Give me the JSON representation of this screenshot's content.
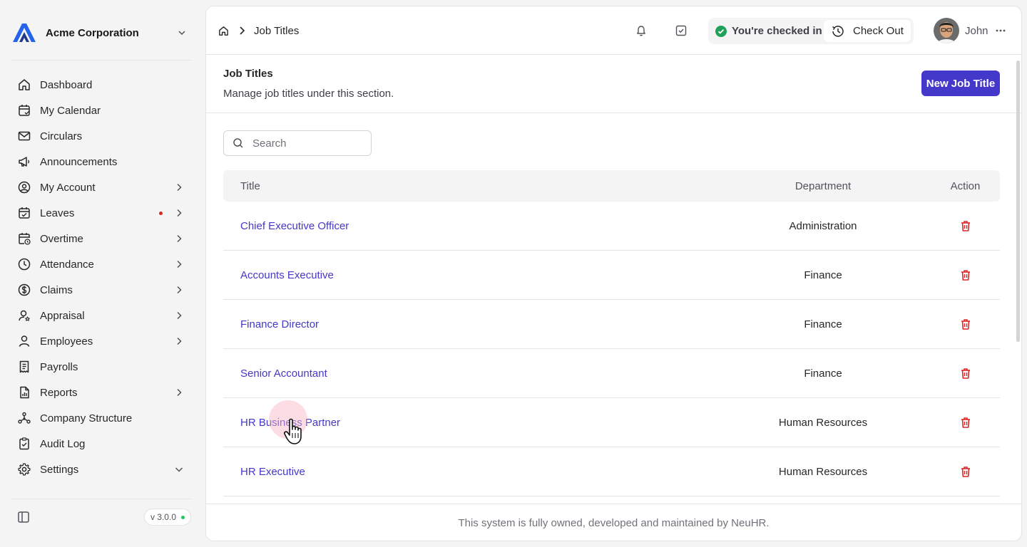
{
  "company": {
    "name": "Acme Corporation"
  },
  "sidebar": {
    "items": [
      {
        "label": "Dashboard",
        "icon": "home-icon",
        "has_arrow": false
      },
      {
        "label": "My Calendar",
        "icon": "calendar-icon",
        "has_arrow": false
      },
      {
        "label": "Circulars",
        "icon": "mail-icon",
        "has_arrow": false
      },
      {
        "label": "Announcements",
        "icon": "megaphone-icon",
        "has_arrow": false
      },
      {
        "label": "My Account",
        "icon": "user-circle-icon",
        "has_arrow": true
      },
      {
        "label": "Leaves",
        "icon": "calendar-check-icon",
        "has_arrow": true,
        "notification_dot": true
      },
      {
        "label": "Overtime",
        "icon": "calendar-clock-icon",
        "has_arrow": true
      },
      {
        "label": "Attendance",
        "icon": "clock-icon",
        "has_arrow": true
      },
      {
        "label": "Claims",
        "icon": "dollar-circle-icon",
        "has_arrow": true
      },
      {
        "label": "Appraisal",
        "icon": "user-star-icon",
        "has_arrow": true
      },
      {
        "label": "Employees",
        "icon": "user-icon",
        "has_arrow": true
      },
      {
        "label": "Payrolls",
        "icon": "receipt-icon",
        "has_arrow": false
      },
      {
        "label": "Reports",
        "icon": "file-chart-icon",
        "has_arrow": true
      },
      {
        "label": "Company Structure",
        "icon": "network-icon",
        "has_arrow": false
      },
      {
        "label": "Audit Log",
        "icon": "clipboard-icon",
        "has_arrow": false
      },
      {
        "label": "Settings",
        "icon": "gear-icon",
        "has_arrow": true,
        "expanded": true
      }
    ]
  },
  "version": "v 3.0.0",
  "breadcrumb": {
    "current": "Job Titles"
  },
  "topbar": {
    "checkin_status": "You're checked in",
    "checkout_label": "Check Out",
    "user_name": "John"
  },
  "page": {
    "title": "Job Titles",
    "subtitle": "Manage job titles under this section.",
    "new_button": "New Job Title"
  },
  "search": {
    "placeholder": "Search",
    "value": ""
  },
  "table": {
    "columns": {
      "title": "Title",
      "department": "Department",
      "action": "Action"
    },
    "rows": [
      {
        "title": "Chief Executive Officer",
        "department": "Administration"
      },
      {
        "title": "Accounts Executive",
        "department": "Finance"
      },
      {
        "title": "Finance Director",
        "department": "Finance"
      },
      {
        "title": "Senior Accountant",
        "department": "Finance"
      },
      {
        "title": "HR Business Partner",
        "department": "Human Resources"
      },
      {
        "title": "HR Executive",
        "department": "Human Resources"
      }
    ]
  },
  "footer": {
    "text": "This system is fully owned, developed and maintained by NeuHR."
  },
  "colors": {
    "primary": "#4338ca",
    "danger": "#dc2626",
    "success": "#22a05a"
  }
}
